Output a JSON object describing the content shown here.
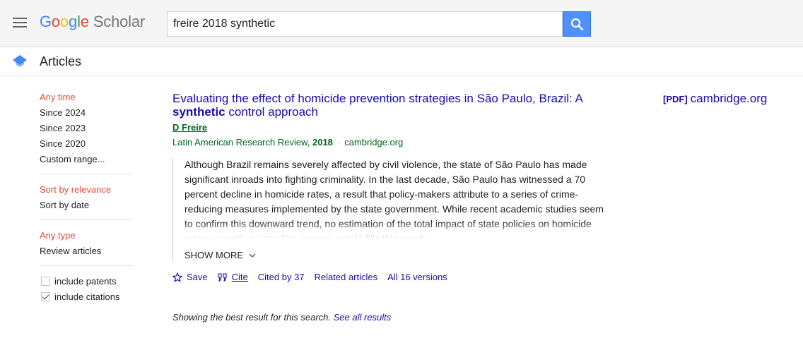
{
  "header": {
    "logo_google": [
      "G",
      "o",
      "o",
      "g",
      "l",
      "e"
    ],
    "logo_google_colors": [
      "#4285f4",
      "#ea4335",
      "#fbbc05",
      "#4285f4",
      "#34a853",
      "#ea4335"
    ],
    "logo_scholar": "Scholar",
    "search_value": "freire 2018 synthetic"
  },
  "subheader": {
    "label": "Articles"
  },
  "sidebar": {
    "time": [
      "Any time",
      "Since 2024",
      "Since 2023",
      "Since 2020",
      "Custom range..."
    ],
    "sort": [
      "Sort by relevance",
      "Sort by date"
    ],
    "type": [
      "Any type",
      "Review articles"
    ],
    "include_patents": "include patents",
    "include_citations": "include citations",
    "include_patents_checked": false,
    "include_citations_checked": true
  },
  "result": {
    "title_part1": "Evaluating the effect of homicide prevention strategies in São Paulo, Brazil: A ",
    "title_bold": "synthetic",
    "title_part2": " control approach",
    "author": "D Freire",
    "venue": "Latin American Research Review, ",
    "year": "2018",
    "separator": "·",
    "source": "cambridge.org",
    "abstract": "Although Brazil remains severely affected by civil violence, the state of São Paulo has made significant inroads into fighting criminality. In the last decade, São Paulo has witnessed a 70 percent decline in homicide rates, a result that policy-makers attribute to a series of crime-reducing measures implemented by the state government. While recent academic studies seem to confirm this downward trend, no estimation of the total impact of state policies on homicide rates currently exists. The present article fills this gap by",
    "show_more": "SHOW MORE",
    "actions": {
      "save": "Save",
      "cite": "Cite",
      "cited_by": "Cited by 37",
      "related": "Related articles",
      "versions": "All 16 versions"
    },
    "pdf_tag": "[PDF]",
    "pdf_source": "cambridge.org"
  },
  "footer": {
    "best_result": "Showing the best result for this search. ",
    "see_all": "See all results"
  }
}
